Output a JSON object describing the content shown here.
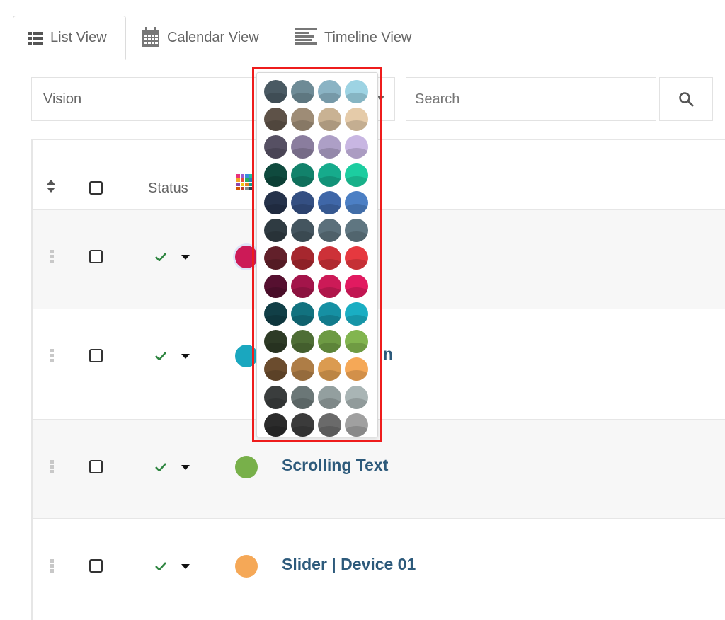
{
  "tabs": [
    {
      "label": "List View",
      "icon": "list-icon",
      "active": true
    },
    {
      "label": "Calendar View",
      "icon": "calendar-icon",
      "active": false
    },
    {
      "label": "Timeline View",
      "icon": "timeline-icon",
      "active": false
    }
  ],
  "filter": {
    "value": "Vision",
    "icon": "chevron-down-icon"
  },
  "search": {
    "placeholder": "Search",
    "icon": "search-icon"
  },
  "table": {
    "header": {
      "status_label": "Status",
      "sort_icon": "sort-icon",
      "color_column_icon": "color-grid-icon"
    },
    "rows": [
      {
        "title": "",
        "color": "#cc1a57",
        "status_icon": "check-icon"
      },
      {
        "title": "n",
        "color": "#1aa7bf",
        "status_icon": "check-icon"
      },
      {
        "title": "Scrolling Text",
        "color": "#78b04a",
        "status_icon": "check-icon"
      },
      {
        "title": "Slider | Device 01",
        "color": "#f5a857",
        "status_icon": "check-icon"
      }
    ]
  },
  "color_picker": {
    "swatches": [
      "#4a5a63",
      "#6e8b96",
      "#8ab3c4",
      "#9dd3e3",
      "#5e5248",
      "#9e8c76",
      "#c9b293",
      "#e5cba9",
      "#565063",
      "#8a7d9e",
      "#ad9fc6",
      "#c8b6e2",
      "#0f4a3e",
      "#12826b",
      "#16ab8c",
      "#1ccda0",
      "#25324a",
      "#344f82",
      "#3f67a8",
      "#4c7fc4",
      "#2f3b42",
      "#44555f",
      "#5b707b",
      "#5f7681",
      "#62202a",
      "#a6272e",
      "#cd3138",
      "#e6383f",
      "#561030",
      "#a3154a",
      "#cc1a57",
      "#e11a60",
      "#113f47",
      "#12727f",
      "#1690a3",
      "#1aaec3",
      "#2e3b26",
      "#4e6e35",
      "#6d9a43",
      "#82b54f",
      "#6b4c2e",
      "#ae7d46",
      "#db9b50",
      "#f5a857",
      "#3a3d3d",
      "#6b7777",
      "#939f9f",
      "#a9b5b5",
      "#2b2b2b",
      "#3b3b3b",
      "#6a6a6a",
      "#a0a0a0"
    ]
  }
}
